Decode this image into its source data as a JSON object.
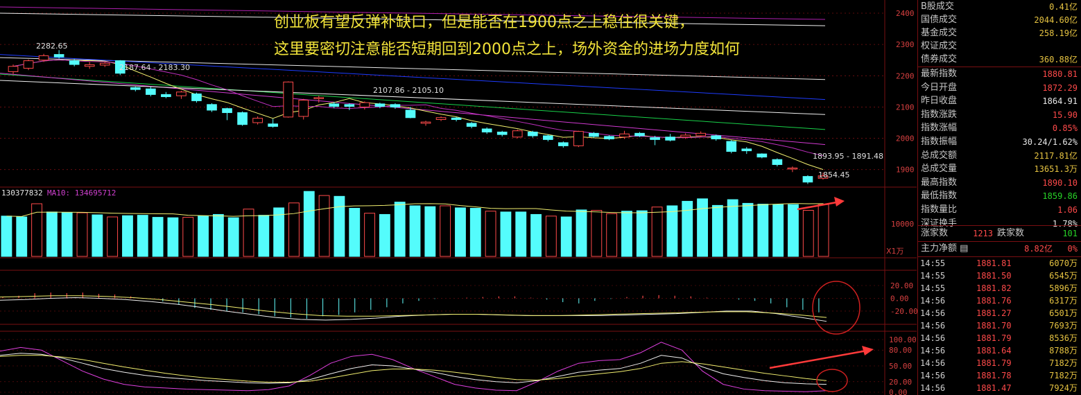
{
  "annotations": {
    "line1": "创业板有望反弹补缺口，但是能否在1900点之上稳住很关键，",
    "line2": "这里要密切注意能否短期回到2000点之上，场外资金的进场力度如何"
  },
  "chart_data": {
    "type": "candlestick",
    "price_axis_ticks": [
      "2400",
      "2300",
      "2200",
      "2100",
      "2000",
      "1900"
    ],
    "price_ylim": [
      1855,
      2420
    ],
    "candles": [
      [
        2213,
        2230,
        2205,
        2236
      ],
      [
        2224,
        2248,
        2218,
        2252
      ],
      [
        2250,
        2264,
        2244,
        2270
      ],
      [
        2268,
        2260,
        2255,
        2282
      ],
      [
        2248,
        2236,
        2230,
        2254
      ],
      [
        2230,
        2235,
        2222,
        2244
      ],
      [
        2234,
        2240,
        2228,
        2244
      ],
      [
        2248,
        2208,
        2202,
        2250
      ],
      [
        2162,
        2156,
        2150,
        2165
      ],
      [
        2158,
        2140,
        2134,
        2164
      ],
      [
        2140,
        2133,
        2128,
        2148
      ],
      [
        2136,
        2148,
        2126,
        2152
      ],
      [
        2142,
        2120,
        2114,
        2146
      ],
      [
        2108,
        2090,
        2084,
        2112
      ],
      [
        2095,
        2082,
        2058,
        2098
      ],
      [
        2082,
        2044,
        2040,
        2086
      ],
      [
        2050,
        2064,
        2044,
        2070
      ],
      [
        2046,
        2038,
        2034,
        2062
      ],
      [
        2068,
        2180,
        2066,
        2182
      ],
      [
        2070,
        2122,
        2060,
        2126
      ],
      [
        2128,
        2130,
        2114,
        2136
      ],
      [
        2110,
        2102,
        2096,
        2116
      ],
      [
        2108,
        2102,
        2090,
        2112
      ],
      [
        2100,
        2114,
        2092,
        2118
      ],
      [
        2110,
        2102,
        2096,
        2114
      ],
      [
        2108,
        2100,
        2094,
        2112
      ],
      [
        2090,
        2066,
        2064,
        2100
      ],
      [
        2048,
        2052,
        2040,
        2056
      ],
      [
        2060,
        2066,
        2055,
        2070
      ],
      [
        2065,
        2060,
        2054,
        2068
      ],
      [
        2048,
        2038,
        2032,
        2052
      ],
      [
        2030,
        2020,
        2014,
        2035
      ],
      [
        2020,
        2012,
        2006,
        2024
      ],
      [
        2004,
        2024,
        2000,
        2028
      ],
      [
        2020,
        2008,
        2002,
        2024
      ],
      [
        2008,
        1996,
        1990,
        2012
      ],
      [
        1986,
        1976,
        1970,
        1990
      ],
      [
        1976,
        2022,
        1972,
        2024
      ],
      [
        2016,
        2006,
        2002,
        2020
      ],
      [
        2006,
        1998,
        1994,
        2010
      ],
      [
        2004,
        2014,
        1998,
        2024
      ],
      [
        2016,
        2008,
        2004,
        2020
      ],
      [
        2002,
        1996,
        1978,
        2008
      ],
      [
        2004,
        1994,
        1990,
        2014
      ],
      [
        2004,
        2010,
        1998,
        2016
      ],
      [
        2008,
        2016,
        2004,
        2022
      ],
      [
        2008,
        1998,
        1992,
        2012
      ],
      [
        1990,
        1958,
        1952,
        1994
      ],
      [
        1966,
        1960,
        1950,
        1972
      ],
      [
        1950,
        1940,
        1936,
        1952
      ],
      [
        1932,
        1916,
        1910,
        1936
      ],
      [
        1902,
        1905,
        1892,
        1910
      ],
      [
        1878,
        1860,
        1854,
        1882
      ],
      [
        1872,
        1880,
        1868,
        1890
      ]
    ],
    "price_annotations": [
      "2282.65",
      "2187.64 - 2183.30",
      "2107.86 - 2105.10",
      "1893.95 - 1891.48",
      "1854.45"
    ],
    "ma_lines": [
      {
        "color": "#e8e8e8",
        "start": 2258,
        "end": 2188
      },
      {
        "color": "#1e3cff",
        "start": 2268,
        "end": 2124
      },
      {
        "color": "#19d34a",
        "start": 2205,
        "end": 2028
      },
      {
        "color": "#d23ad2",
        "start": 2208,
        "end": 1980
      },
      {
        "color": "#f0f0f0",
        "start": 2185,
        "end": 2076
      },
      {
        "color": "#f0f0f0",
        "start": 2400,
        "end": 2360
      },
      {
        "color": "#b020b0",
        "start": 2420,
        "end": 2380
      }
    ],
    "volume": {
      "label": "130377832",
      "ma_label": "MA10: 134695712",
      "axis_tick": "10000",
      "unit": "X1万",
      "ylim": [
        0,
        16000
      ],
      "values": [
        9800,
        9600,
        12800,
        10800,
        10700,
        10600,
        10100,
        9600,
        9900,
        10000,
        9500,
        9400,
        9500,
        9800,
        10200,
        9400,
        11500,
        10000,
        11800,
        13000,
        15800,
        14800,
        14600,
        11700,
        10500,
        10200,
        13200,
        12300,
        12100,
        12300,
        11800,
        11700,
        11000,
        10800,
        10800,
        10200,
        9800,
        9600,
        11300,
        11200,
        10400,
        11000,
        11100,
        12000,
        12300,
        13400,
        14000,
        12400,
        13800,
        12900,
        12700,
        12600,
        12600,
        11200,
        12600
      ],
      "up": [
        false,
        false,
        true,
        false,
        false,
        true,
        false,
        true,
        false,
        false,
        false,
        false,
        true,
        false,
        false,
        false,
        true,
        false,
        false,
        true,
        false,
        true,
        false,
        false,
        true,
        false,
        false,
        false,
        false,
        true,
        false,
        false,
        true,
        false,
        false,
        false,
        true,
        false,
        false,
        true,
        true,
        false,
        false,
        true,
        false,
        false,
        false,
        false,
        false,
        false,
        false,
        false,
        false,
        true,
        true
      ]
    },
    "macd": {
      "axis_ticks": [
        "20.00",
        "0.00",
        "-20.00"
      ],
      "ylim": [
        -45,
        25
      ],
      "hist": [
        2,
        4,
        8,
        9,
        8,
        9,
        7,
        6,
        3,
        0,
        -5,
        -10,
        -15,
        -18,
        -20,
        -22,
        -25,
        -28,
        -30,
        -32,
        -28,
        -26,
        -22,
        -18,
        -14,
        -8,
        -4,
        -1,
        0,
        1,
        2,
        3,
        3,
        1,
        -2,
        -6,
        -8,
        -4,
        -1,
        2,
        4,
        5,
        4,
        3,
        1,
        0,
        -2,
        -4,
        -8,
        -14,
        -18,
        -22
      ],
      "dif": [
        -3,
        -2,
        0,
        1,
        0,
        -2,
        -5,
        -9,
        -14,
        -20,
        -25,
        -30,
        -33,
        -34,
        -33,
        -31,
        -28,
        -26,
        -25,
        -25,
        -26,
        -27,
        -27,
        -27,
        -27,
        -26,
        -25,
        -24,
        -22,
        -20,
        -20,
        -24,
        -30,
        -36
      ],
      "dea": [
        2,
        3,
        4,
        4,
        3,
        1,
        -2,
        -6,
        -10,
        -15,
        -20,
        -24,
        -27,
        -28,
        -28,
        -27,
        -26,
        -25,
        -25,
        -26,
        -27,
        -27,
        -26,
        -25,
        -24,
        -23,
        -22,
        -21,
        -21,
        -23,
        -26,
        -30
      ]
    },
    "kdj": {
      "axis_ticks": [
        "100.00",
        "80.00",
        "50.00",
        "20.00",
        "0.00"
      ],
      "ylim": [
        0,
        100
      ],
      "k": [
        70,
        74,
        72,
        65,
        55,
        45,
        38,
        32,
        28,
        25,
        22,
        20,
        18,
        17,
        18,
        24,
        35,
        45,
        52,
        50,
        44,
        38,
        30,
        24,
        20,
        18,
        22,
        30,
        38,
        42,
        45,
        55,
        70,
        65,
        48,
        35,
        28,
        22,
        18,
        16,
        15
      ],
      "d": [
        68,
        70,
        70,
        67,
        62,
        55,
        48,
        42,
        36,
        31,
        27,
        24,
        21,
        19,
        19,
        21,
        27,
        34,
        41,
        44,
        44,
        42,
        38,
        33,
        28,
        24,
        23,
        26,
        31,
        35,
        39,
        45,
        55,
        58,
        54,
        48,
        42,
        36,
        31,
        26,
        22
      ],
      "j": [
        78,
        85,
        80,
        60,
        40,
        25,
        15,
        10,
        8,
        6,
        5,
        4,
        3,
        5,
        12,
        32,
        55,
        68,
        72,
        62,
        45,
        30,
        15,
        8,
        4,
        3,
        20,
        40,
        55,
        60,
        62,
        75,
        95,
        80,
        40,
        15,
        6,
        3,
        2,
        1,
        3
      ]
    }
  },
  "side": {
    "rows": [
      {
        "k": "B股成交",
        "v": "0.41亿",
        "c": "yel"
      },
      {
        "k": "国债成交",
        "v": "2044.60亿",
        "c": "yel"
      },
      {
        "k": "基金成交",
        "v": "258.19亿",
        "c": "yel"
      },
      {
        "k": "权证成交",
        "v": "",
        "c": "yel"
      },
      {
        "k": "债券成交",
        "v": "360.88亿",
        "c": "yel"
      },
      {
        "k": "最新指数",
        "v": "1880.81",
        "c": "red"
      },
      {
        "k": "今日开盘",
        "v": "1872.29",
        "c": "red"
      },
      {
        "k": "昨日收盘",
        "v": "1864.91",
        "c": "wht"
      },
      {
        "k": "指数涨跌",
        "v": "15.90",
        "c": "red"
      },
      {
        "k": "指数涨幅",
        "v": "0.85%",
        "c": "red"
      },
      {
        "k": "指数振幅",
        "v": "30.24/1.62%",
        "c": "wht"
      },
      {
        "k": "总成交额",
        "v": "2117.81亿",
        "c": "yel"
      },
      {
        "k": "总成交量",
        "v": "13651.3万",
        "c": "yel"
      },
      {
        "k": "最高指数",
        "v": "1890.10",
        "c": "red"
      },
      {
        "k": "最低指数",
        "v": "1859.86",
        "c": "grn"
      },
      {
        "k": "指数量比",
        "v": "1.06",
        "c": "red"
      },
      {
        "k": "深证换手",
        "v": "1.78%",
        "c": "wht"
      }
    ],
    "breadth": {
      "up_label": "涨家数",
      "up_value": "1213",
      "down_label": "跌家数",
      "down_value": "101"
    },
    "flow": {
      "label": "主力净额",
      "value": "8.82亿",
      "pct": "0%"
    },
    "ticks": [
      {
        "t": "14:55",
        "p": "1881.81",
        "v": "6070万"
      },
      {
        "t": "14:55",
        "p": "1881.50",
        "v": "6545万"
      },
      {
        "t": "14:55",
        "p": "1881.82",
        "v": "5896万"
      },
      {
        "t": "14:56",
        "p": "1881.76",
        "v": "6317万"
      },
      {
        "t": "14:56",
        "p": "1881.27",
        "v": "6501万"
      },
      {
        "t": "14:56",
        "p": "1881.70",
        "v": "7693万"
      },
      {
        "t": "14:56",
        "p": "1881.79",
        "v": "8536万"
      },
      {
        "t": "14:56",
        "p": "1881.64",
        "v": "8788万"
      },
      {
        "t": "14:56",
        "p": "1881.79",
        "v": "7182万"
      },
      {
        "t": "14:56",
        "p": "1881.78",
        "v": "7182万"
      },
      {
        "t": "14:56",
        "p": "1881.47",
        "v": "7924万"
      }
    ]
  },
  "colors": {
    "up": "#ff4a4a",
    "down": "#54fcfc",
    "grid": "#7a0f12",
    "axis_text": "#d84040"
  }
}
